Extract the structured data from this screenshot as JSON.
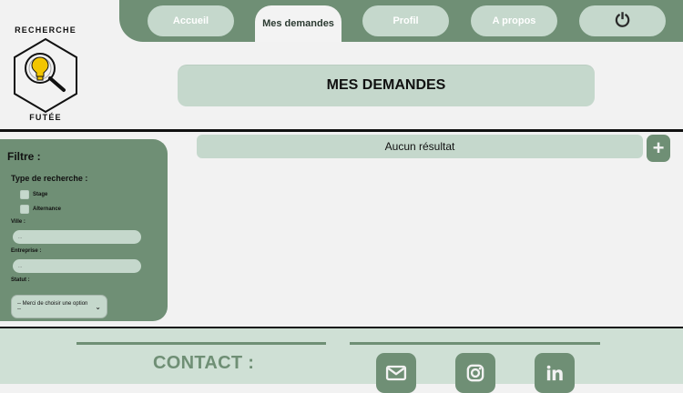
{
  "logo": {
    "title": "RECHERCHE",
    "subtitle": "FUTÉE"
  },
  "nav": {
    "items": [
      {
        "label": "Accueil"
      },
      {
        "label": "Mes demandes"
      },
      {
        "label": "Profil"
      },
      {
        "label": "A propos"
      }
    ],
    "power_icon": "⏻"
  },
  "page": {
    "title": "MES DEMANDES"
  },
  "filter": {
    "title": "Filtre :",
    "type_label": "Type de recherche :",
    "options": [
      "Stage",
      "Alternance"
    ],
    "ville_label": "Ville :",
    "ville_value": "...",
    "entreprise_label": "Entreprise :",
    "entreprise_value": "...",
    "statut_label": "Statut :",
    "statut_select": "-- Merci de choisir une option --"
  },
  "results": {
    "empty_text": "Aucun résultat",
    "add_icon": "+"
  },
  "footer": {
    "contact_label": "CONTACT :",
    "icons": [
      "mail-icon",
      "instagram-icon",
      "linkedin-icon"
    ]
  },
  "colors": {
    "green": "#6f8f75",
    "mint": "#c5d8cc",
    "background": "#f2f2f2"
  }
}
